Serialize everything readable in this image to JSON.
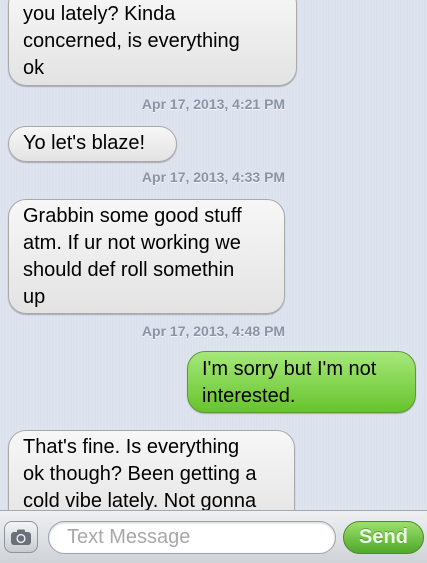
{
  "conversation": {
    "messages": [
      {
        "direction": "incoming",
        "lines": [
          "you lately? Kinda",
          "concerned, is everything",
          "ok"
        ]
      },
      {
        "timestamp": "Apr 17, 2013, 4:21 PM"
      },
      {
        "direction": "incoming",
        "lines": [
          "Yo let's blaze!"
        ]
      },
      {
        "timestamp": "Apr 17, 2013, 4:33 PM"
      },
      {
        "direction": "incoming",
        "lines": [
          "Grabbin some good stuff",
          "atm. If ur not working we",
          "should def roll somethin",
          "up"
        ]
      },
      {
        "timestamp": "Apr 17, 2013, 4:48 PM"
      },
      {
        "direction": "outgoing",
        "lines": [
          "I'm sorry but I'm not",
          "interested."
        ]
      },
      {
        "direction": "incoming",
        "lines": [
          "That's fine. Is everything",
          "ok though? Been getting a",
          "cold vibe lately. Not gonna"
        ]
      }
    ]
  },
  "toolbar": {
    "camera_icon": "camera-icon",
    "input_placeholder": "Text Message",
    "input_value": "",
    "send_label": "Send"
  },
  "colors": {
    "thread_background": "#dbe2ed",
    "incoming_bubble": "#e8e8e8",
    "outgoing_bubble": "#7fd24a",
    "timestamp_text": "#8b95a5",
    "send_button": "#6bc23a"
  }
}
